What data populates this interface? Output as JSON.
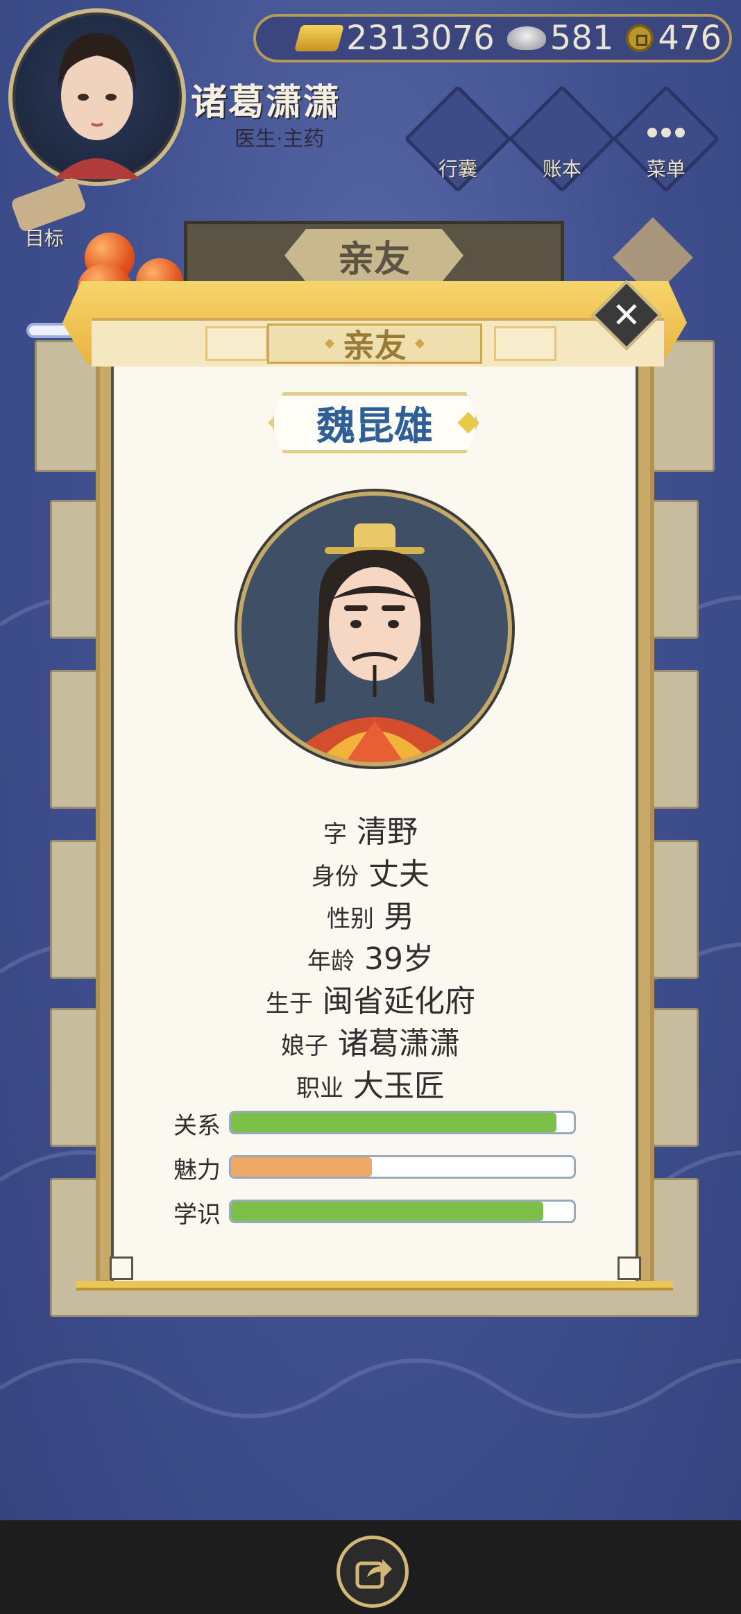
{
  "header": {
    "player_name": "诸葛潇潇",
    "player_title": "医生·主药",
    "currency": {
      "gold": "2313076",
      "silver": "581",
      "coin": "476"
    },
    "menu": [
      {
        "label": "行囊",
        "icon": "bag-icon"
      },
      {
        "label": "账本",
        "icon": "ledger-icon"
      },
      {
        "label": "菜单",
        "icon": "more-icon"
      }
    ],
    "goal_label": "目标"
  },
  "background_panel": {
    "title": "亲友"
  },
  "dialog": {
    "tab_title": "亲友",
    "name": "魏昆雄",
    "info": [
      {
        "key": "字",
        "value": "清野"
      },
      {
        "key": "身份",
        "value": "丈夫"
      },
      {
        "key": "性别",
        "value": "男"
      },
      {
        "key": "年龄",
        "value": "39岁"
      },
      {
        "key": "生于",
        "value": "闽省延化府"
      },
      {
        "key": "娘子",
        "value": "诸葛潇潇"
      },
      {
        "key": "职业",
        "value": "大玉匠"
      }
    ],
    "stats": [
      {
        "label": "关系",
        "fraction": 0.95,
        "color": "#7cc04a"
      },
      {
        "label": "魅力",
        "fraction": 0.41,
        "color": "#f0a866"
      },
      {
        "label": "学识",
        "fraction": 0.91,
        "color": "#7cc04a"
      }
    ]
  },
  "footer": {
    "share_icon": "share-icon"
  }
}
